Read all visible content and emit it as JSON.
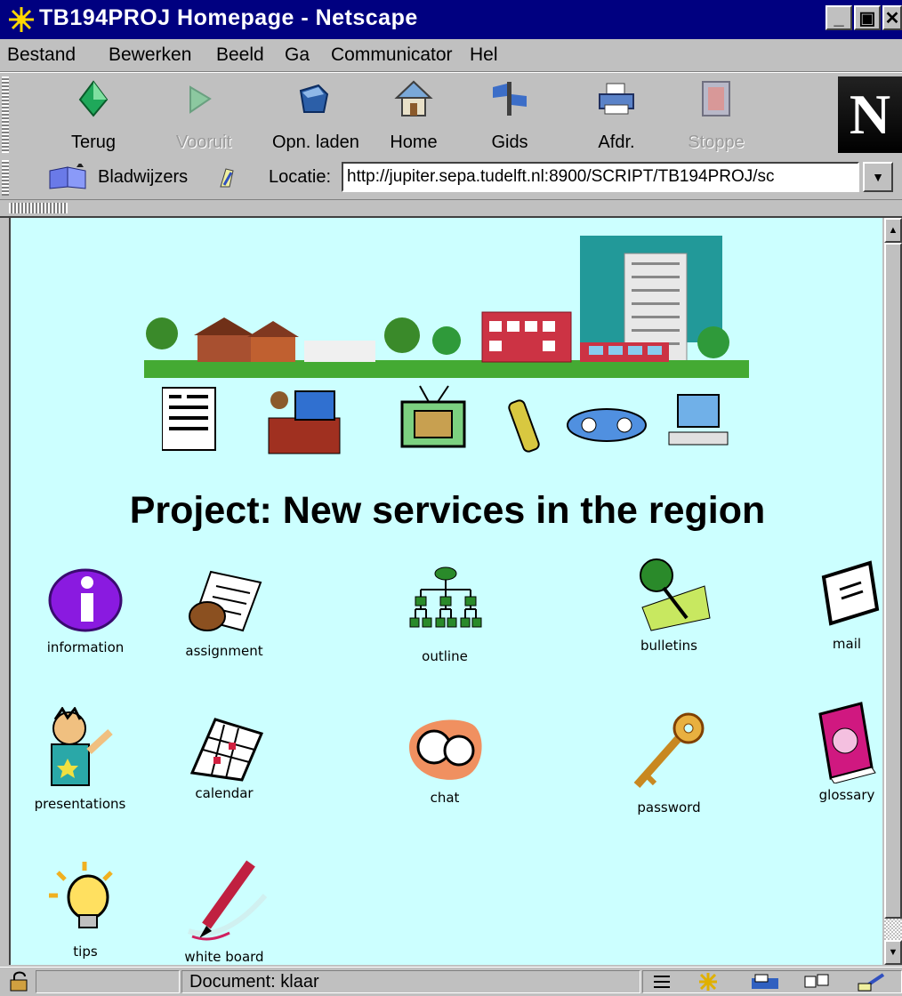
{
  "window": {
    "title": "TB194PROJ Homepage - Netscape",
    "controls": [
      "_",
      "▣",
      "✕"
    ]
  },
  "menu": [
    {
      "label": "Bestand",
      "underline": "B",
      "rest": "estand"
    },
    {
      "label": "Bewerken",
      "pre": "Be",
      "underline": "w",
      "rest": "erken"
    },
    {
      "label": "Beeld",
      "pre": "Beel",
      "underline": "d",
      "rest": ""
    },
    {
      "label": "Ga",
      "underline": "G",
      "rest": "a"
    },
    {
      "label": "Communicator",
      "underline": "C",
      "rest": "ommunicator"
    },
    {
      "label": "Hel",
      "underline": "H",
      "rest": "el"
    }
  ],
  "toolbar": {
    "buttons": [
      {
        "label": "Terug",
        "icon": "back-arrow-icon",
        "enabled": true
      },
      {
        "label": "Vooruit",
        "icon": "forward-arrow-icon",
        "enabled": false
      },
      {
        "label": "Opn. laden",
        "icon": "reload-icon",
        "enabled": true
      },
      {
        "label": "Home",
        "icon": "home-icon",
        "enabled": true
      },
      {
        "label": "Gids",
        "icon": "guide-icon",
        "enabled": true
      },
      {
        "label": "Afdr.",
        "icon": "print-icon",
        "enabled": true
      },
      {
        "label": "Stoppe",
        "icon": "stop-icon",
        "enabled": false
      }
    ],
    "logo": "N"
  },
  "location": {
    "bookmarks_label": "Bladwijzers",
    "label": "Locatie:",
    "url": "http://jupiter.sepa.tudelft.nl:8900/SCRIPT/TB194PROJ/sc"
  },
  "page": {
    "title": "Project: New services in the region",
    "nav": [
      {
        "label": "information",
        "icon": "information-icon"
      },
      {
        "label": "assignment",
        "icon": "assignment-icon"
      },
      {
        "label": "outline",
        "icon": "outline-icon"
      },
      {
        "label": "bulletins",
        "icon": "bulletins-icon"
      },
      {
        "label": "mail",
        "icon": "mail-icon"
      },
      {
        "label": "presentations",
        "icon": "presentations-icon"
      },
      {
        "label": "calendar",
        "icon": "calendar-icon"
      },
      {
        "label": "chat",
        "icon": "chat-icon"
      },
      {
        "label": "password",
        "icon": "password-icon"
      },
      {
        "label": "glossary",
        "icon": "glossary-icon"
      },
      {
        "label": "tips",
        "icon": "tips-icon"
      },
      {
        "label": "white board",
        "icon": "white-board-icon"
      }
    ]
  },
  "status": {
    "text": "Document: klaar"
  },
  "colors": {
    "titlebar": "#000080",
    "chrome": "#c0c0c0",
    "content_bg": "#ccffff"
  }
}
